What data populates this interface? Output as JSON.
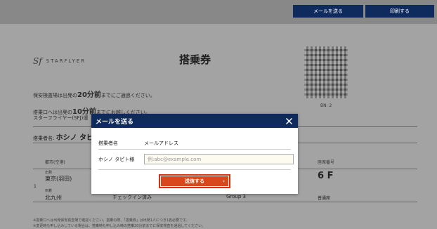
{
  "toolbar": {
    "mail_label": "メールを送る",
    "print_label": "印刷する"
  },
  "ticket": {
    "logo_mark": "Sf",
    "logo_text": "STARFLYER",
    "title": "搭乗券",
    "bn": "BN: 2",
    "security_prefix": "保安検査場は出発の",
    "security_time": "20分前",
    "security_suffix": "までにご通過ください。",
    "gate_prefix": "搭乗口へは出発の",
    "gate_time": "10分前",
    "gate_suffix": "までにお越しください。",
    "notice": "スターフライヤー(SFJ)運",
    "passenger_label": "搭乗者名:",
    "passenger_name": "ホシノ タピ",
    "route_header": "都市(空港)",
    "seat_header": "座席番号",
    "row_number": "1",
    "dep_label": "出発",
    "dep_city": "東京(羽田)",
    "arr_label": "到着",
    "arr_city": "北九州",
    "check_status": "チェックイン済み",
    "group": "Group 3",
    "seat": "6 F",
    "seat_type": "普通席",
    "footnote1": "※搭乗口へは出発保安検査場で確認ください。搭乗の際、「搭乗券」は出発1人につき1枚必要です。",
    "footnote2": "※変更時も申し込みしている場合は、搭乗時も申し込み時の搭乗20分前までに保安検査を通過してください。"
  },
  "modal": {
    "title": "メールを送る",
    "name_label": "搭乗者名",
    "email_header": "メールアドレス",
    "passenger_name": "ホシノ タピト様",
    "email_placeholder": "例:abc@example.com",
    "send_label": "送信する",
    "send_arrow": "›"
  },
  "colors": {
    "navy": "#0f2a5c",
    "accent": "#d9481c"
  }
}
